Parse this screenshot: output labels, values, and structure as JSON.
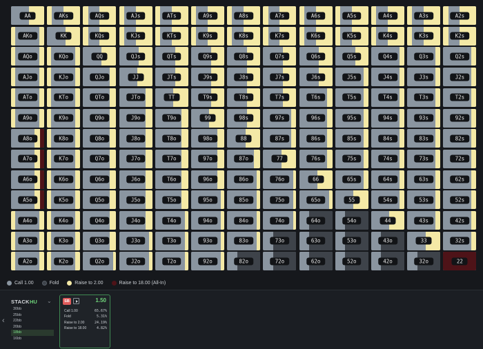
{
  "colors": {
    "call": "#8a95a0",
    "fold": "#3e434a",
    "raise": "#f4e9a6",
    "allin": "#4e1318"
  },
  "ranks": [
    "A",
    "K",
    "Q",
    "J",
    "T",
    "9",
    "8",
    "7",
    "6",
    "5",
    "4",
    "3",
    "2"
  ],
  "legend": [
    {
      "label": "Call 1.00",
      "color": "#8a95a0",
      "icon": "call-dot"
    },
    {
      "label": "Fold",
      "color": "#3e434a",
      "icon": "fold-dot"
    },
    {
      "label": "Raise to 2.00",
      "color": "#f4e9a6",
      "icon": "raise-dot"
    },
    {
      "label": "Raise to 18.00 (All-In)",
      "color": "#4e1318",
      "icon": "allin-dot"
    }
  ],
  "stack": {
    "title": "STACK",
    "mode": "HU",
    "items": [
      "30bb",
      "25bb",
      "22bb",
      "20bb",
      "18bb",
      "16bb"
    ],
    "selected": "18bb"
  },
  "action_card": {
    "position": "SB",
    "amount": "1.50",
    "actions": [
      {
        "label": "Call 1.00",
        "pct": "65.67%"
      },
      {
        "label": "Fold",
        "pct": "5.31%"
      },
      {
        "label": "Raise to 2.00",
        "pct": "24.19%"
      },
      {
        "label": "Raise to 18.00",
        "pct": "4.82%"
      }
    ]
  }
}
